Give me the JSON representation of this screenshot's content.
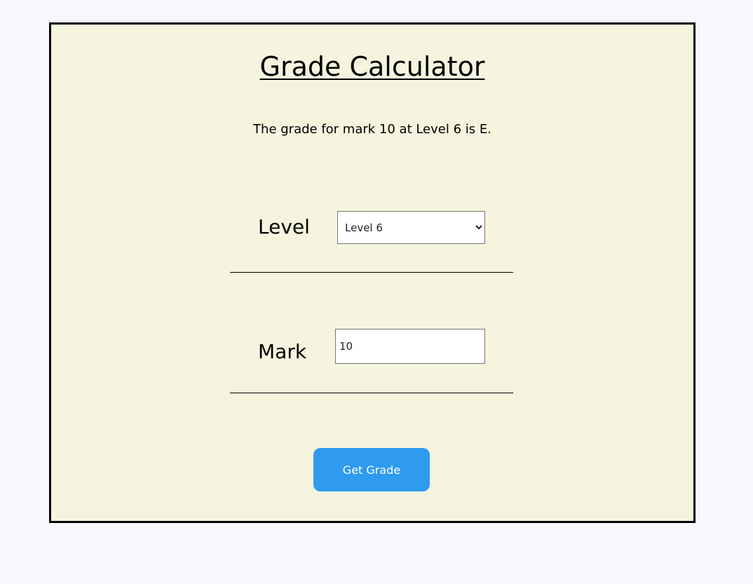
{
  "page": {
    "title": "Grade Calculator",
    "result_text": "The grade for mark 10 at Level 6 is E."
  },
  "form": {
    "level": {
      "label": "Level",
      "selected_value": "Level 6"
    },
    "mark": {
      "label": "Mark",
      "value": "10"
    },
    "submit_label": "Get Grade"
  },
  "colors": {
    "page_background": "#f7f8fd",
    "card_background": "#f5f4de",
    "button_background": "#2e9bef",
    "button_text": "#ffffff"
  }
}
